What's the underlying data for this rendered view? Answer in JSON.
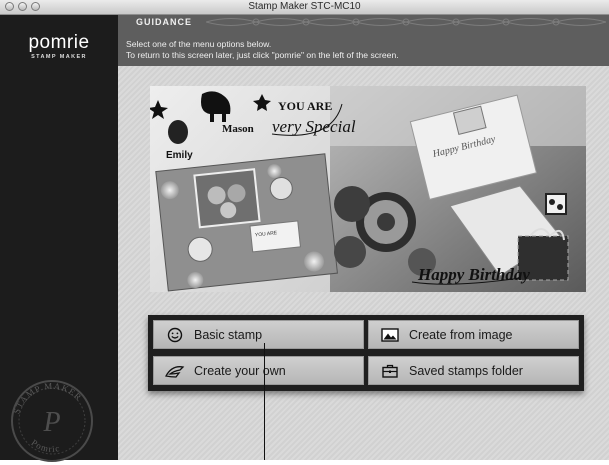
{
  "window": {
    "title": "Stamp Maker STC-MC10"
  },
  "sidebar": {
    "logo": "pomrie",
    "logo_subtitle": "STAMP MAKER",
    "seal_text": "STAMP MAKER",
    "seal_text_bottom": "Pomric",
    "seal_monogram": "P"
  },
  "header": {
    "section_label": "GUIDANCE",
    "instruction_line1": "Select one of the menu options below.",
    "instruction_line2": "To return to this screen later, just click \"pomrie\" on the left of the screen."
  },
  "photo": {
    "text_you_are": "YOU ARE",
    "text_very_special": "very Special",
    "text_mason": "Mason",
    "text_emily": "Emily",
    "text_happy_birthday": "Happy Birthday",
    "card_text": "Happy Birthday"
  },
  "menu": {
    "basic_stamp": "Basic stamp",
    "create_from_image": "Create from image",
    "create_your_own": "Create your own",
    "saved_stamps_folder": "Saved stamps folder"
  },
  "colors": {
    "sidebar": "#1c1c1c",
    "header": "#5e5e5e",
    "menu_frame": "#1f1f1f"
  }
}
